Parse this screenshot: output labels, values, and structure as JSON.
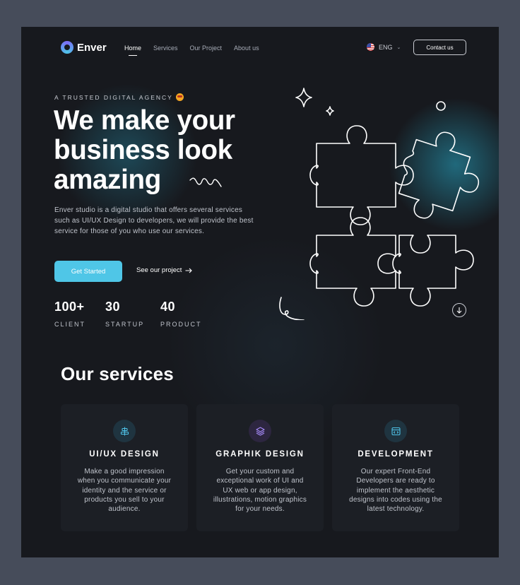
{
  "brand": {
    "name": "Enver"
  },
  "nav": {
    "items": [
      {
        "label": "Home",
        "active": true
      },
      {
        "label": "Services",
        "active": false
      },
      {
        "label": "Our Project",
        "active": false
      },
      {
        "label": "About us",
        "active": false
      }
    ],
    "language": "ENG",
    "contact_label": "Contact us"
  },
  "hero": {
    "eyebrow": "A TRUSTED DIGITAL AGENCY",
    "title": "We make your business look amazing",
    "description": "Enver studio is a digital studio that offers several services such as UI/UX Design to developers, we will provide the best service for those of you who use our services.",
    "primary_cta": "Get Started",
    "secondary_cta": "See our project"
  },
  "stats": [
    {
      "value": "100+",
      "label": "CLIENT"
    },
    {
      "value": "30",
      "label": "STARTUP"
    },
    {
      "value": "40",
      "label": "PRODUCT"
    }
  ],
  "services": {
    "title": "Our services",
    "cards": [
      {
        "title": "UI/UX DESIGN",
        "description": "Make a good impression when you communicate your identity and the service or products you sell to your audience.",
        "icon": "align-icon",
        "accent": "#4fc3e8"
      },
      {
        "title": "GRAPHIK DESIGN",
        "description": "Get your custom and exceptional work of UI and UX web or app design, illustrations, motion graphics for your needs.",
        "icon": "layers-icon",
        "accent": "#a78bfa"
      },
      {
        "title": "DEVELOPMENT",
        "description": "Our expert Front-End Developers are ready to implement the aesthetic designs into codes using the latest technology.",
        "icon": "browser-code-icon",
        "accent": "#4fc3e8"
      }
    ]
  },
  "colors": {
    "background": "#17191e",
    "accent": "#4fc6e7",
    "card": "#1c1f25"
  }
}
